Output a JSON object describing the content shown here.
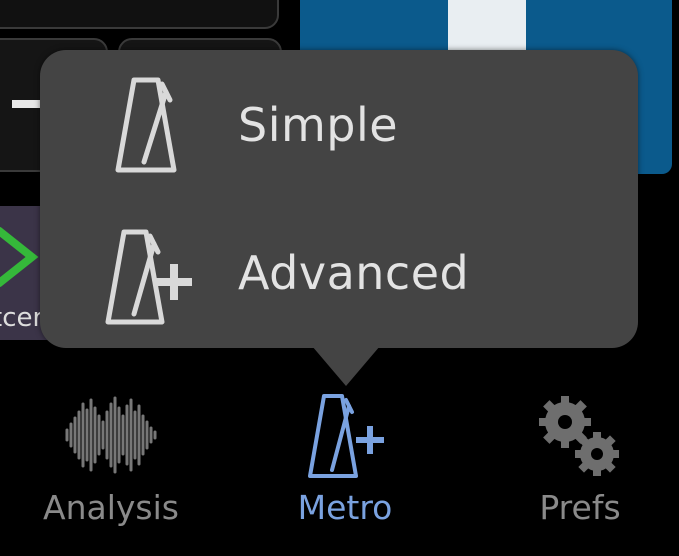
{
  "menu": {
    "items": [
      {
        "label": "Simple",
        "icon": "metronome-icon"
      },
      {
        "label": "Advanced",
        "icon": "metronome-plus-icon"
      }
    ]
  },
  "background": {
    "tile_label": "tcer"
  },
  "tabbar": {
    "tabs": [
      {
        "label": "Analysis",
        "icon": "waveform-icon",
        "active": false
      },
      {
        "label": "Metro",
        "icon": "metronome-plus-icon",
        "active": true
      },
      {
        "label": "Prefs",
        "icon": "gears-icon",
        "active": false
      }
    ]
  },
  "colors": {
    "popup_bg": "#444444",
    "active_tab": "#7aa2e0",
    "inactive_tab": "#8a8a8a",
    "blue_panel": "#0b5a8c",
    "chevron_green": "#35b83a"
  }
}
